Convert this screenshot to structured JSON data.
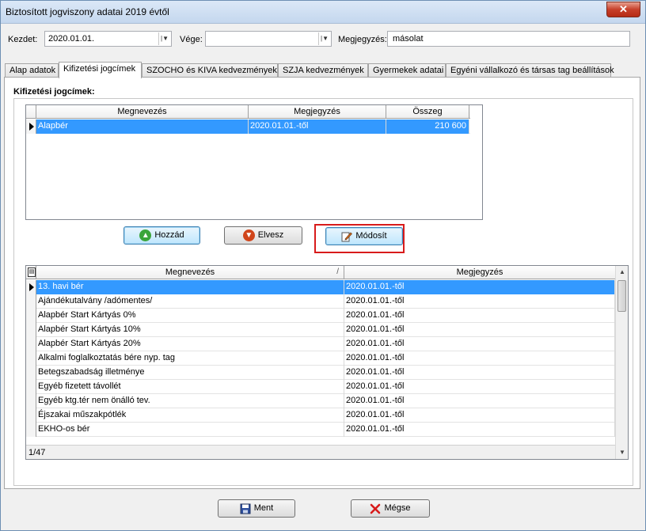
{
  "window": {
    "title": "Biztosított jogviszony adatai 2019 évtől",
    "close_label": "✕"
  },
  "top_fields": {
    "kezdet_label": "Kezdet:",
    "kezdet_value": "2020.01.01.",
    "vege_label": "Vége:",
    "vege_value": "",
    "megjegyzes_label": "Megjegyzés:",
    "megjegyzes_value": "másolat"
  },
  "tabs": [
    {
      "label": "Alap adatok"
    },
    {
      "label": "Kifizetési jogcímek"
    },
    {
      "label": "SZOCHO és KIVA kedvezmények"
    },
    {
      "label": "SZJA kedvezmények"
    },
    {
      "label": "Gyermekek adatai"
    },
    {
      "label": "Egyéni vállalkozó és társas tag beállítások"
    }
  ],
  "active_tab": "Kifizetési jogcímek",
  "section": {
    "title": "Kifizetési jogcímek:"
  },
  "upper_grid": {
    "columns": [
      "Megnevezés",
      "Megjegyzés",
      "Összeg"
    ],
    "rows": [
      {
        "name": "Alapbér",
        "note": "2020.01.01.-től",
        "amount": "210 600"
      }
    ]
  },
  "buttons": {
    "hozzad": "Hozzád",
    "elvesz": "Elvesz",
    "modosit": "Módosít",
    "ment": "Ment",
    "megse": "Mégse"
  },
  "lower_grid": {
    "columns": [
      "Megnevezés",
      "Megjegyzés"
    ],
    "sort_indicator": "/",
    "rows": [
      {
        "name": "13. havi bér",
        "note": "2020.01.01.-től"
      },
      {
        "name": "Ajándékutalvány /adómentes/",
        "note": "2020.01.01.-től"
      },
      {
        "name": "Alapbér Start Kártyás 0%",
        "note": "2020.01.01.-től"
      },
      {
        "name": "Alapbér Start Kártyás 10%",
        "note": "2020.01.01.-től"
      },
      {
        "name": "Alapbér Start Kártyás 20%",
        "note": "2020.01.01.-től"
      },
      {
        "name": "Alkalmi foglalkoztatás bére nyp. tag",
        "note": "2020.01.01.-től"
      },
      {
        "name": "Betegszabadság illetménye",
        "note": "2020.01.01.-től"
      },
      {
        "name": "Egyéb fizetett távollét",
        "note": "2020.01.01.-től"
      },
      {
        "name": "Egyéb ktg.tér nem önálló tev.",
        "note": "2020.01.01.-től"
      },
      {
        "name": "Éjszakai műszakpótlék",
        "note": "2020.01.01.-től"
      },
      {
        "name": "EKHO-os bér",
        "note": "2020.01.01.-től"
      }
    ],
    "record_counter": "1/47"
  },
  "colors": {
    "selection": "#3399ff",
    "highlight_box": "#d81b1b",
    "add_icon": "#3aa53a",
    "remove_icon": "#d0451b",
    "cancel_icon": "#d81b1b",
    "save_icon": "#2e4f9e"
  }
}
